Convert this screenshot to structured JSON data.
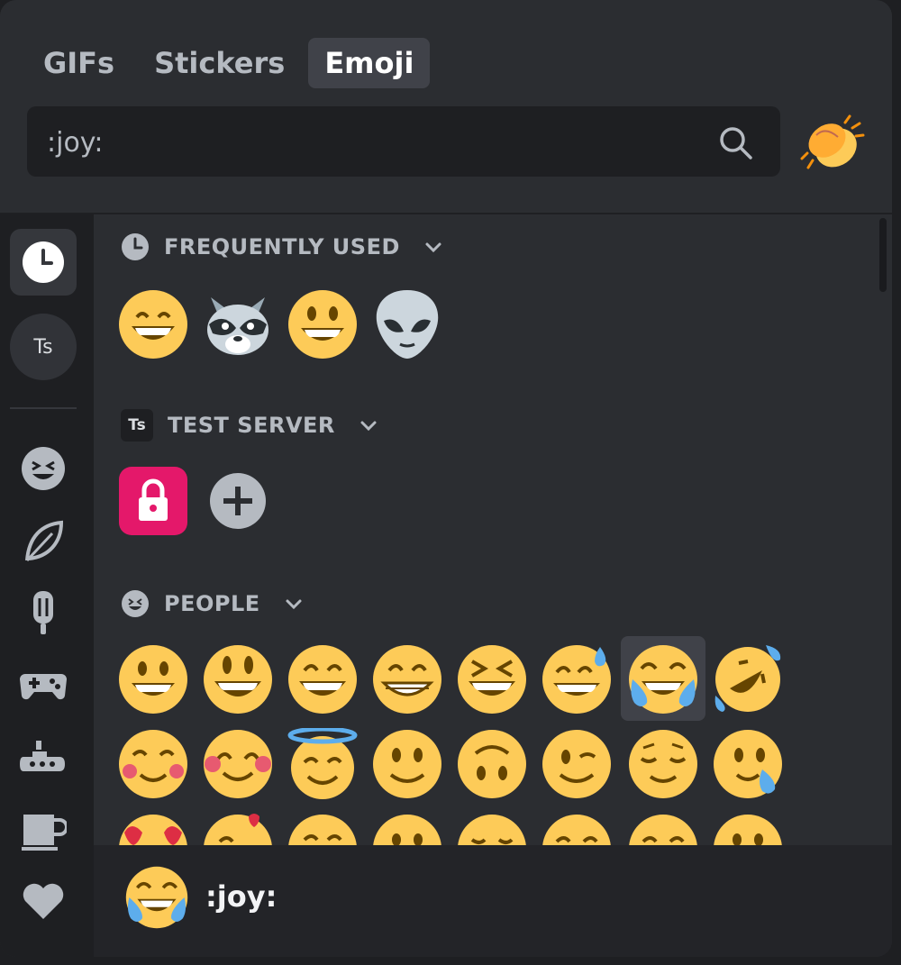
{
  "tabs": [
    {
      "label": "GIFs",
      "active": false
    },
    {
      "label": "Stickers",
      "active": false
    },
    {
      "label": "Emoji",
      "active": true
    }
  ],
  "search": {
    "value": ":joy:",
    "placeholder": ""
  },
  "skin_tone_icon": "clapping-hands-icon",
  "rail": {
    "items": [
      {
        "name": "recent-icon",
        "active": true
      },
      {
        "name": "server-Ts",
        "label": "Ts"
      },
      {
        "name": "smiley-icon"
      },
      {
        "name": "leaf-icon"
      },
      {
        "name": "popsicle-icon"
      },
      {
        "name": "gamepad-icon"
      },
      {
        "name": "submarine-icon"
      },
      {
        "name": "coffee-icon"
      },
      {
        "name": "heart-icon"
      }
    ]
  },
  "sections": {
    "frequent": {
      "label": "FREQUENTLY USED",
      "emojis": [
        "grinning-smiling-eyes",
        "raccoon",
        "grinning-face",
        "alien"
      ]
    },
    "server": {
      "label": "TEST SERVER",
      "badge": "Ts",
      "items": [
        "lock-custom-emoji",
        "add-emoji"
      ]
    },
    "people": {
      "label": "PEOPLE"
    }
  },
  "footer": {
    "name": ":joy:",
    "emoji": "joy"
  },
  "colors": {
    "bg": "#2b2d31",
    "rail": "#1e1f22",
    "accent_pink": "#e4186a",
    "emoji_yellow": "#fdcb58"
  }
}
